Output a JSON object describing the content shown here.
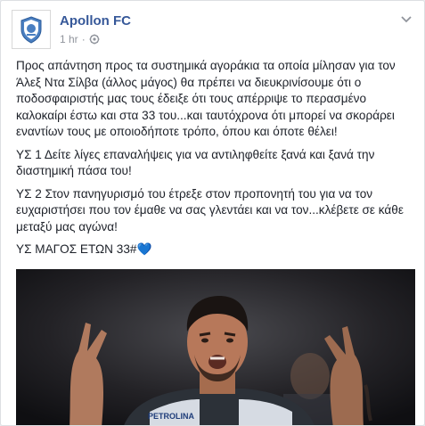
{
  "post": {
    "page_name": "Apollon FC",
    "time": "1 hr",
    "separator": "·",
    "paragraphs": [
      "Προς απάντηση προς τα συστημικά αγοράκια τα οποία μίλησαν για τον Άλεξ Ντα Σίλβα (άλλος μάγος) θα πρέπει να διευκρινίσουμε ότι ο ποδοσφαιριστής μας τους έδειξε ότι τους απέρριψε το περασμένο καλοκαίρι έστω και στα 33 του...και ταυτόχρονα ότι μπορεί να σκοράρει εναντίων τους με οποιοδήποτε τρόπο, όπου και όποτε θέλει!",
      "ΥΣ 1 Δείτε λίγες επαναλήψεις για να αντιληφθείτε ξανά και ξανά την διαστημική πάσα του!",
      "ΥΣ 2 Στον πανηγυρισμό του έτρεξε στον προπονητή του για να τον ευχαριστήσει που τον έμαθε να σας γλεντάει και να τον...κλέβετε σε κάθε μεταξύ μας αγώνα!",
      "ΥΣ ΜΑΓΟΣ ΕΤΩΝ 33#"
    ],
    "heart_emoji": "💙",
    "sponsor_text": "PETROLINA"
  },
  "colors": {
    "link": "#365899",
    "text": "#1d2129",
    "meta": "#90949c",
    "jersey": "#2c3138",
    "heart": "#4aa3ef"
  },
  "icons": {
    "avatar": "apollon-crest-icon",
    "privacy": "globe-gear-icon",
    "menu": "chevron-down-icon"
  }
}
